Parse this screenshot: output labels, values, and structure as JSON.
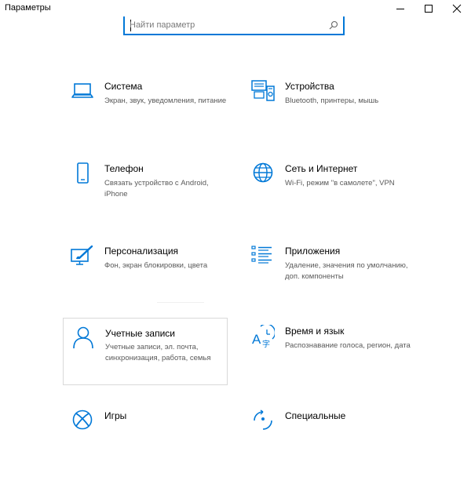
{
  "window": {
    "title": "Параметры"
  },
  "search": {
    "placeholder": "Найти параметр",
    "value": ""
  },
  "tiles": [
    {
      "title": "Система",
      "desc": "Экран, звук, уведомления, питание",
      "icon": "laptop-icon"
    },
    {
      "title": "Устройства",
      "desc": "Bluetooth, принтеры, мышь",
      "icon": "devices-icon"
    },
    {
      "title": "Телефон",
      "desc": "Связать устройство с Android, iPhone",
      "icon": "phone-icon"
    },
    {
      "title": "Сеть и Интернет",
      "desc": "Wi-Fi, режим \"в самолете\", VPN",
      "icon": "globe-icon"
    },
    {
      "title": "Персонализация",
      "desc": "Фон, экран блокировки, цвета",
      "icon": "personalization-icon"
    },
    {
      "title": "Приложения",
      "desc": "Удаление, значения по умолчанию, доп. компоненты",
      "icon": "apps-list-icon"
    },
    {
      "title": "Учетные записи",
      "desc": "Учетные записи, эл. почта, синхронизация, работа, семья",
      "icon": "person-icon"
    },
    {
      "title": "Время и язык",
      "desc": "Распознавание голоса, регион, дата",
      "icon": "time-language-icon"
    },
    {
      "title": "Игры",
      "desc": "",
      "icon": "xbox-icon"
    },
    {
      "title": "Специальные",
      "desc": "",
      "icon": "accessibility-icon"
    }
  ],
  "colors": {
    "accent": "#0078d7",
    "desc_text": "#595959",
    "hover_border": "#d9d9d9"
  }
}
